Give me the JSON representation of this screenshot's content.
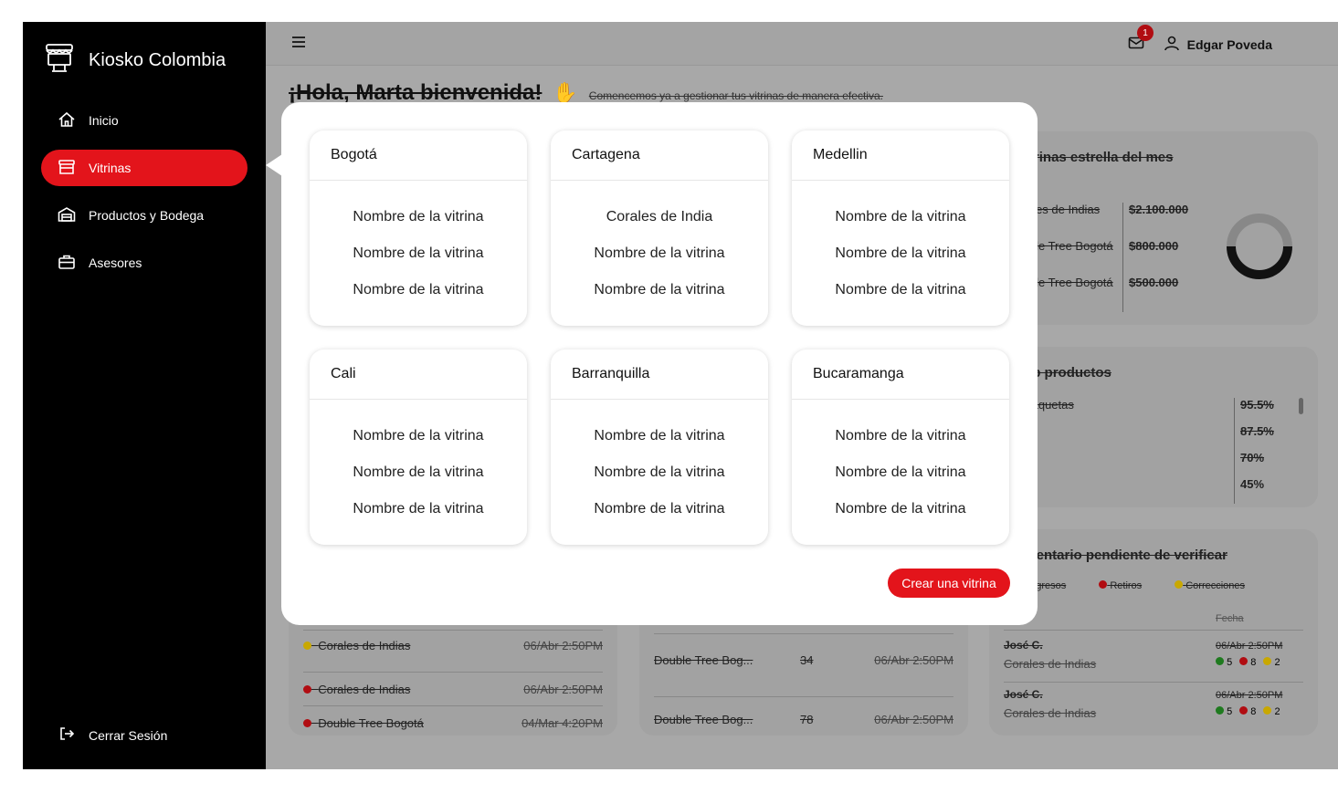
{
  "app": {
    "brand": "Kiosko Colombia"
  },
  "sidebar": {
    "items": [
      {
        "label": "Inicio",
        "icon": "home-icon"
      },
      {
        "label": "Vitrinas",
        "icon": "store-icon",
        "active": true
      },
      {
        "label": "Productos y Bodega",
        "icon": "warehouse-icon"
      },
      {
        "label": "Asesores",
        "icon": "briefcase-icon"
      }
    ],
    "logout": "Cerrar Sesión"
  },
  "topbar": {
    "notifications": "1",
    "user": "Edgar Poveda"
  },
  "greeting": {
    "title": "¡Hola, Marta bienvenida!",
    "subtitle": "Comencemos ya a gestionar tus vitrinas de manera efectiva."
  },
  "background": {
    "estrella": {
      "title": "Vitrinas estrella del mes",
      "rows": [
        {
          "name": "Corales de Indias",
          "value": "$2.100.000"
        },
        {
          "name": "Double Tree Bogotá",
          "value": "$800.000"
        },
        {
          "name": "Double Tree Bogotá",
          "value": "$500.000"
        }
      ]
    },
    "top": {
      "title": "Top productos",
      "rows": [
        {
          "name": "Chaquetas",
          "value": "95.5%"
        },
        {
          "name": "",
          "value": "87.5%"
        },
        {
          "name": "",
          "value": "70%"
        },
        {
          "name": "",
          "value": "45%"
        }
      ]
    },
    "inventario": {
      "title": "Inventario pendiente de verificar",
      "legend": [
        "Ingresos",
        "Retiros",
        "Correcciones"
      ],
      "date_header": "Fecha",
      "rows": [
        {
          "name": "José C.",
          "place": "Corales de Indias",
          "date": "06/Abr 2:50PM",
          "g": "5",
          "r": "8",
          "y": "2"
        },
        {
          "name": "José C.",
          "place": "Corales de Indias",
          "date": "06/Abr 2:50PM",
          "g": "5",
          "r": "8",
          "y": "2"
        }
      ]
    },
    "left_list": [
      {
        "name": "Corales de Indias",
        "date": "06/Abr 2:50PM",
        "color": "#c9a800"
      },
      {
        "name": "Corales de Indias",
        "date": "06/Abr 2:50PM",
        "color": "#b10d12"
      },
      {
        "name": "Double Tree Bogotá",
        "date": "04/Mar 4:20PM",
        "color": "#b10d12"
      }
    ],
    "mid_list": [
      {
        "name": "Double Tree Bog...",
        "qty": "34",
        "date": "06/Abr 2:50PM"
      },
      {
        "name": "Double Tree Bog...",
        "qty": "78",
        "date": "06/Abr 2:50PM"
      }
    ]
  },
  "modal": {
    "cities": [
      {
        "name": "Bogotá",
        "items": [
          "Nombre de la vitrina",
          "Nombre de la vitrina",
          "Nombre de la vitrina"
        ]
      },
      {
        "name": "Cartagena",
        "items": [
          "Corales de India",
          "Nombre de la vitrina",
          "Nombre de la vitrina"
        ]
      },
      {
        "name": "Medellin",
        "items": [
          "Nombre de la vitrina",
          "Nombre de la vitrina",
          "Nombre de la vitrina"
        ]
      },
      {
        "name": "Cali",
        "items": [
          "Nombre de la vitrina",
          "Nombre de la vitrina",
          "Nombre de la vitrina"
        ]
      },
      {
        "name": "Barranquilla",
        "items": [
          "Nombre de la vitrina",
          "Nombre de la vitrina",
          "Nombre de la vitrina"
        ]
      },
      {
        "name": "Bucaramanga",
        "items": [
          "Nombre de la vitrina",
          "Nombre de la vitrina",
          "Nombre de la vitrina"
        ]
      }
    ],
    "create_button": "Crear una vitrina"
  },
  "colors": {
    "accent": "#e3141b",
    "sidebar": "#000000",
    "overlay": "#a8a8a8"
  }
}
